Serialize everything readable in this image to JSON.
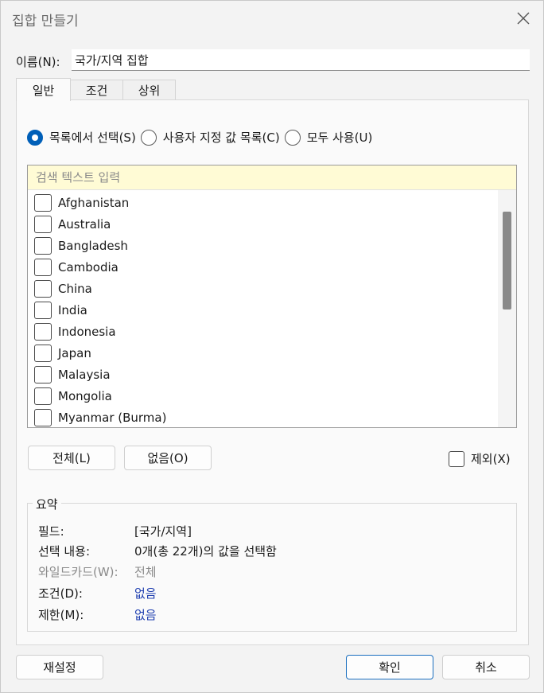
{
  "window": {
    "title": "집합 만들기"
  },
  "name": {
    "label": "이름(N):",
    "value": "국가/지역 집합"
  },
  "tabs": [
    {
      "label": "일반",
      "active": true
    },
    {
      "label": "조건",
      "active": false
    },
    {
      "label": "상위",
      "active": false
    }
  ],
  "mode": {
    "options": [
      {
        "label": "목록에서 선택(S)",
        "selected": true
      },
      {
        "label": "사용자 지정 값 목록(C)",
        "selected": false
      },
      {
        "label": "모두 사용(U)",
        "selected": false
      }
    ]
  },
  "list": {
    "search_placeholder": "검색 텍스트 입력",
    "items": [
      "Afghanistan",
      "Australia",
      "Bangladesh",
      "Cambodia",
      "China",
      "India",
      "Indonesia",
      "Japan",
      "Malaysia",
      "Mongolia",
      "Myanmar (Burma)"
    ]
  },
  "buttons": {
    "all": "전체(L)",
    "none": "없음(O)",
    "reset": "재설정",
    "ok": "확인",
    "cancel": "취소"
  },
  "exclude": {
    "label": "제외(X)",
    "checked": false
  },
  "summary": {
    "title": "요약",
    "field_label": "필드:",
    "field_value": "[국가/지역]",
    "selection_label": "선택 내용:",
    "selection_value": "0개(총 22개)의 값을 선택함",
    "wildcard_label": "와일드카드(W):",
    "wildcard_value": "전체",
    "condition_label": "조건(D):",
    "condition_value": "없음",
    "limit_label": "제한(M):",
    "limit_value": "없음"
  },
  "colors": {
    "accent": "#005fb8",
    "search_bg": "#fffbd5",
    "link": "#1f3fb0"
  }
}
